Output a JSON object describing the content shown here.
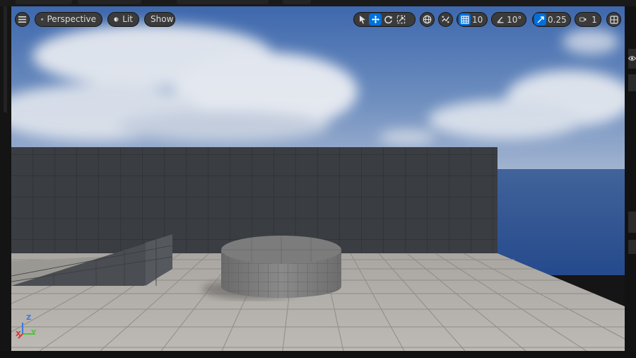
{
  "toolbar": {
    "menu_icon": "hamburger-icon",
    "view_mode_label": "Perspective",
    "view_mode_icon": "cube-icon",
    "lighting_label": "Lit",
    "lighting_icon": "sphere-icon",
    "show_label": "Show",
    "transform_tools": [
      {
        "name": "select-tool",
        "icon": "cursor-icon",
        "active": false
      },
      {
        "name": "move-tool",
        "icon": "move-arrows-icon",
        "active": true
      },
      {
        "name": "rotate-tool",
        "icon": "rotate-icon",
        "active": false
      },
      {
        "name": "scale-tool",
        "icon": "scale-icon",
        "active": false
      }
    ],
    "world_space_icon": "globe-icon",
    "surface_snap_icon": "snap-icon",
    "grid_snap_value": "10",
    "rotation_snap_value": "10°",
    "scale_snap_value": "0.25",
    "camera_speed_value": "1",
    "layout_icon": "viewport-layout-icon"
  },
  "gizmo": {
    "x_label": "X",
    "y_label": "Y",
    "z_label": "Z"
  },
  "colors": {
    "accent": "#0070e0",
    "sky_top": "#3b64a8",
    "ocean": "#2c4e8e",
    "floor": "#b4b0ab",
    "wall": "#3a3d42",
    "axis_x": "#e03434",
    "axis_y": "#4ec43a",
    "axis_z": "#3a7ae0"
  }
}
